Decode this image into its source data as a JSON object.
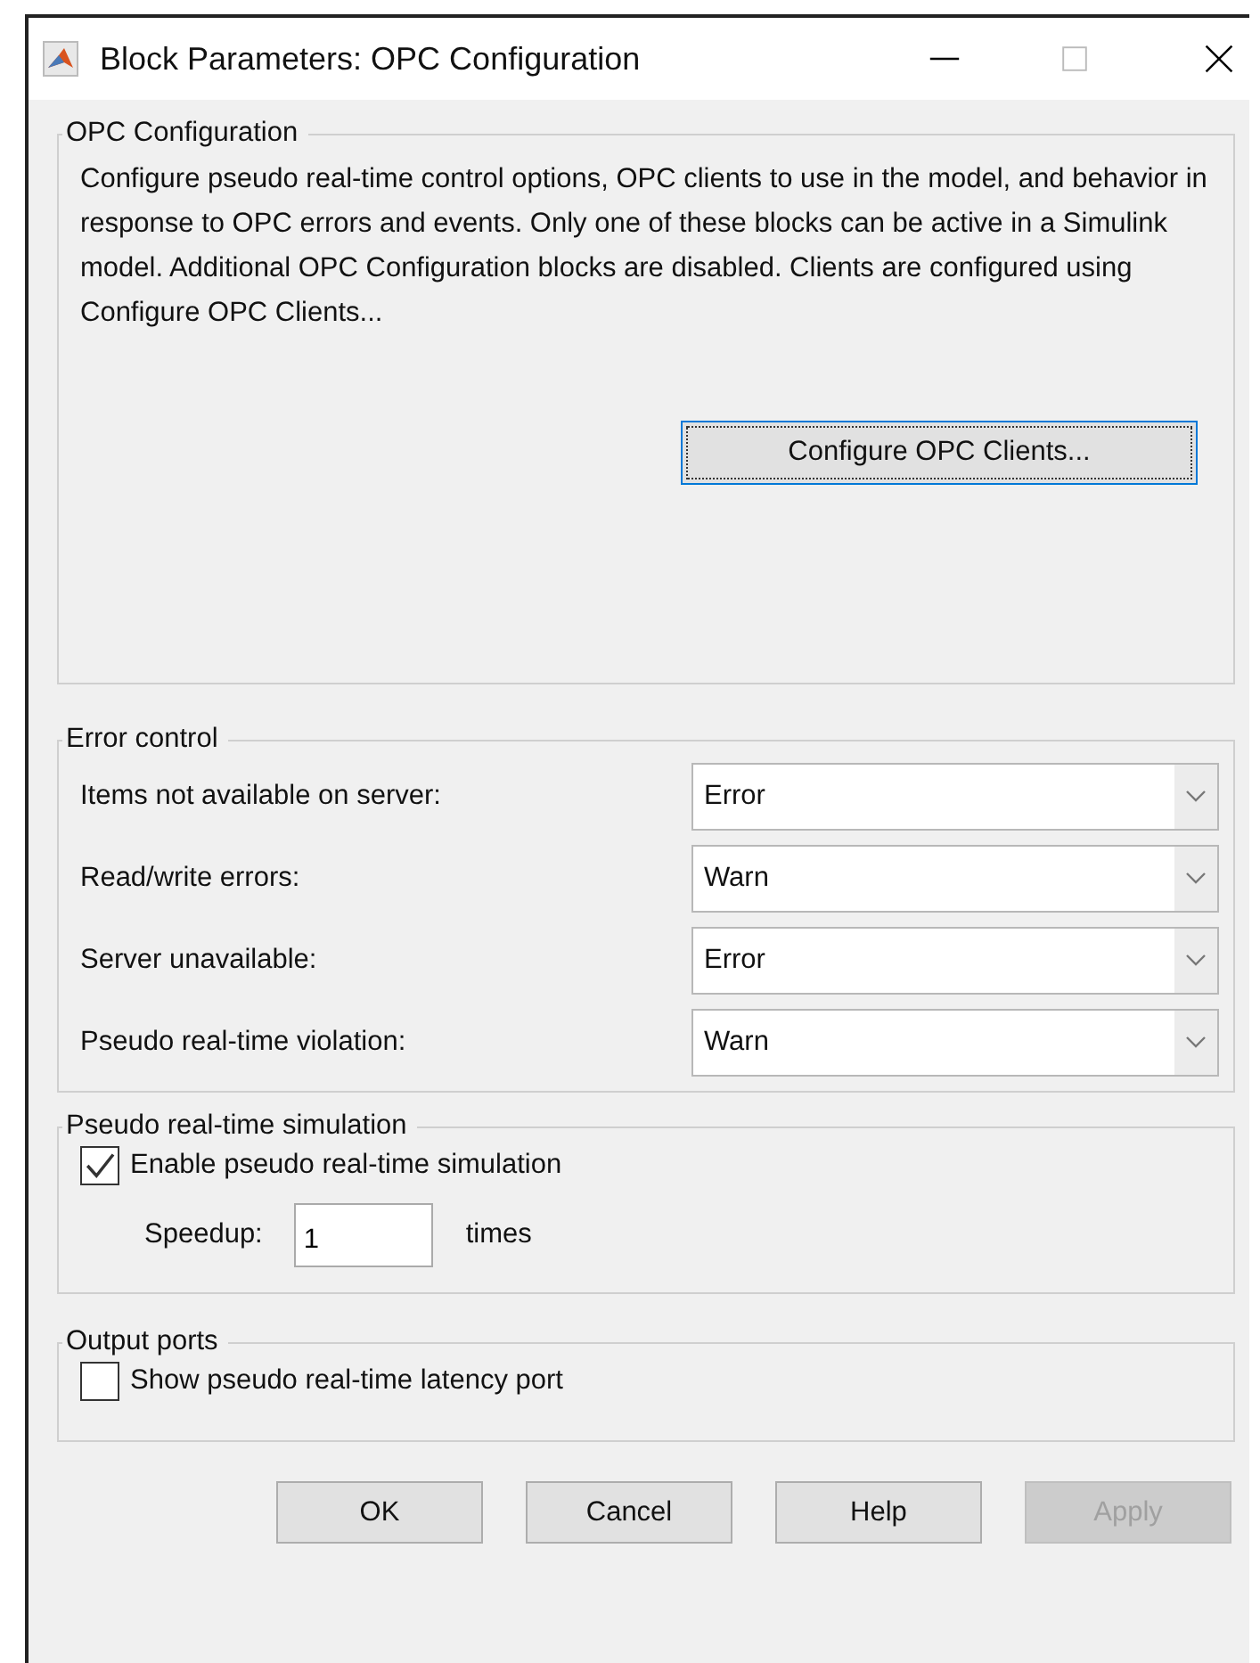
{
  "window": {
    "title": "Block Parameters: OPC Configuration"
  },
  "opc_configuration": {
    "title": "OPC Configuration",
    "description": "Configure pseudo real-time control options, OPC clients to use in the model, and behavior in response to OPC errors and events. Only one of these blocks can be active in a Simulink model. Additional OPC Configuration blocks are disabled. Clients are configured using Configure OPC Clients...",
    "button": "Configure OPC Clients..."
  },
  "error_control": {
    "title": "Error control",
    "rows": [
      {
        "label": "Items not available on server:",
        "value": "Error"
      },
      {
        "label": "Read/write errors:",
        "value": "Warn"
      },
      {
        "label": "Server unavailable:",
        "value": "Error"
      },
      {
        "label": "Pseudo real-time violation:",
        "value": "Warn"
      }
    ]
  },
  "pseudo_real_time": {
    "title": "Pseudo real-time simulation",
    "checkbox": {
      "label": "Enable pseudo real-time simulation",
      "checked": true
    },
    "speedup": {
      "label": "Speedup:",
      "value": "1",
      "unit": "times"
    }
  },
  "output_ports": {
    "title": "Output ports",
    "checkbox": {
      "label": "Show pseudo real-time latency port",
      "checked": false
    }
  },
  "buttons": [
    {
      "label": "OK",
      "disabled": false
    },
    {
      "label": "Cancel",
      "disabled": false
    },
    {
      "label": "Help",
      "disabled": false
    },
    {
      "label": "Apply",
      "disabled": true
    }
  ]
}
